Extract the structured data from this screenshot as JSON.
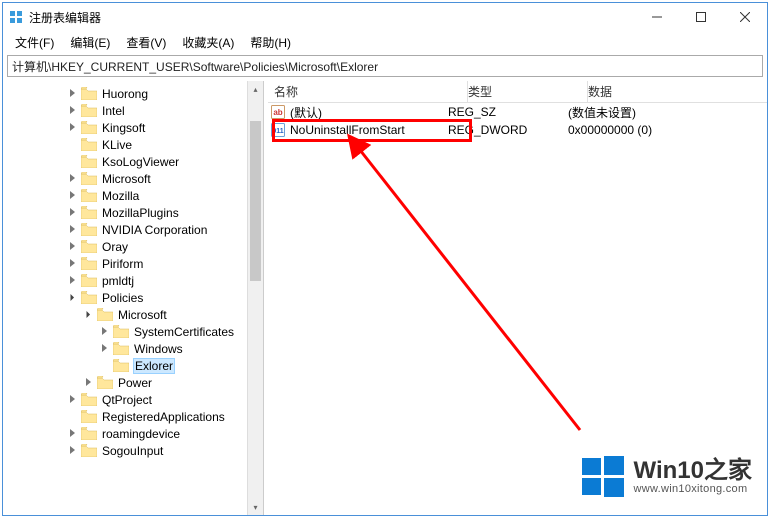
{
  "window": {
    "title": "注册表编辑器"
  },
  "menu": {
    "file": "文件(F)",
    "edit": "编辑(E)",
    "view": "查看(V)",
    "fav": "收藏夹(A)",
    "help": "帮助(H)"
  },
  "address": "计算机\\HKEY_CURRENT_USER\\Software\\Policies\\Microsoft\\Exlorer",
  "columns": {
    "name": "名称",
    "type": "类型",
    "data": "数据"
  },
  "values": [
    {
      "icon": "string",
      "name": "(默认)",
      "type": "REG_SZ",
      "data": "(数值未设置)"
    },
    {
      "icon": "dword",
      "name": "NoUninstallFromStart",
      "type": "REG_DWORD",
      "data": "0x00000000 (0)"
    }
  ],
  "tree": [
    {
      "indent": 4,
      "exp": "closed",
      "label": "Huorong"
    },
    {
      "indent": 4,
      "exp": "closed",
      "label": "Intel"
    },
    {
      "indent": 4,
      "exp": "closed",
      "label": "Kingsoft"
    },
    {
      "indent": 4,
      "exp": "none",
      "label": "KLive"
    },
    {
      "indent": 4,
      "exp": "none",
      "label": "KsoLogViewer"
    },
    {
      "indent": 4,
      "exp": "closed",
      "label": "Microsoft"
    },
    {
      "indent": 4,
      "exp": "closed",
      "label": "Mozilla"
    },
    {
      "indent": 4,
      "exp": "closed",
      "label": "MozillaPlugins"
    },
    {
      "indent": 4,
      "exp": "closed",
      "label": "NVIDIA Corporation"
    },
    {
      "indent": 4,
      "exp": "closed",
      "label": "Oray"
    },
    {
      "indent": 4,
      "exp": "closed",
      "label": "Piriform"
    },
    {
      "indent": 4,
      "exp": "closed",
      "label": "pmldtj"
    },
    {
      "indent": 4,
      "exp": "open",
      "label": "Policies"
    },
    {
      "indent": 5,
      "exp": "open",
      "label": "Microsoft"
    },
    {
      "indent": 6,
      "exp": "closed",
      "label": "SystemCertificates"
    },
    {
      "indent": 6,
      "exp": "closed",
      "label": "Windows"
    },
    {
      "indent": 6,
      "exp": "none",
      "label": "Exlorer",
      "selected": true
    },
    {
      "indent": 5,
      "exp": "closed",
      "label": "Power"
    },
    {
      "indent": 4,
      "exp": "closed",
      "label": "QtProject"
    },
    {
      "indent": 4,
      "exp": "none",
      "label": "RegisteredApplications"
    },
    {
      "indent": 4,
      "exp": "closed",
      "label": "roamingdevice"
    },
    {
      "indent": 4,
      "exp": "closed",
      "label": "SogouInput"
    }
  ],
  "watermark": {
    "title": "Win10之家",
    "url": "www.win10xitong.com"
  }
}
